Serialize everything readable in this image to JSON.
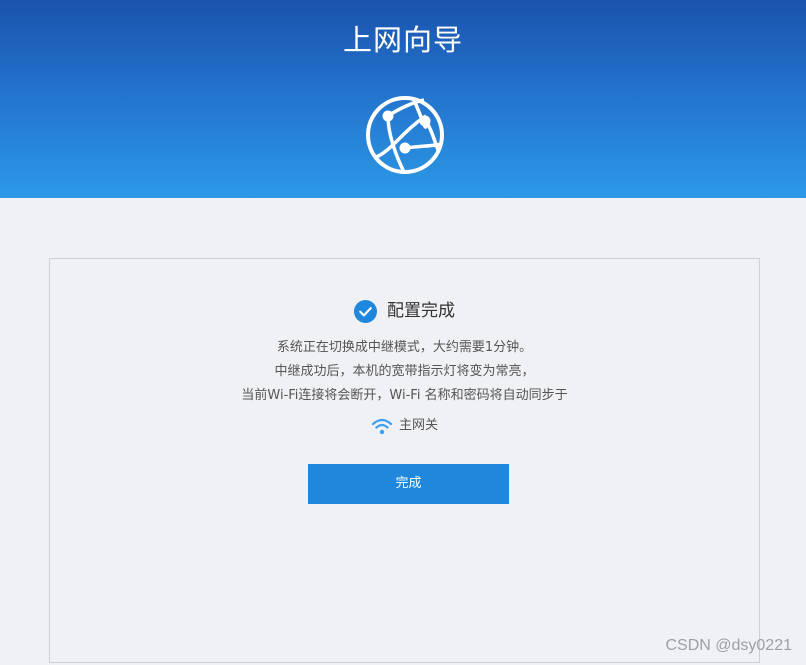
{
  "header": {
    "title": "上网向导",
    "icon": "globe-network-icon"
  },
  "card": {
    "status_icon": "check-circle-icon",
    "status_text": "配置完成",
    "message_line1": "系统正在切换成中继模式，大约需要1分钟。",
    "message_line2": "中继成功后，本机的宽带指示灯将变为常亮，",
    "message_line3": "当前Wi-Fi连接将会断开，Wi-Fi 名称和密码将自动同步于",
    "gateway_icon": "wifi-icon",
    "gateway_text": "主网关",
    "done_button_label": "完成"
  },
  "watermark": "CSDN @dsy0221",
  "colors": {
    "header_top": "#1a53ad",
    "header_bottom": "#2c99e6",
    "accent": "#1f88dc",
    "page_background": "#f0f1f5",
    "wifi_icon": "#3aa0f0"
  }
}
